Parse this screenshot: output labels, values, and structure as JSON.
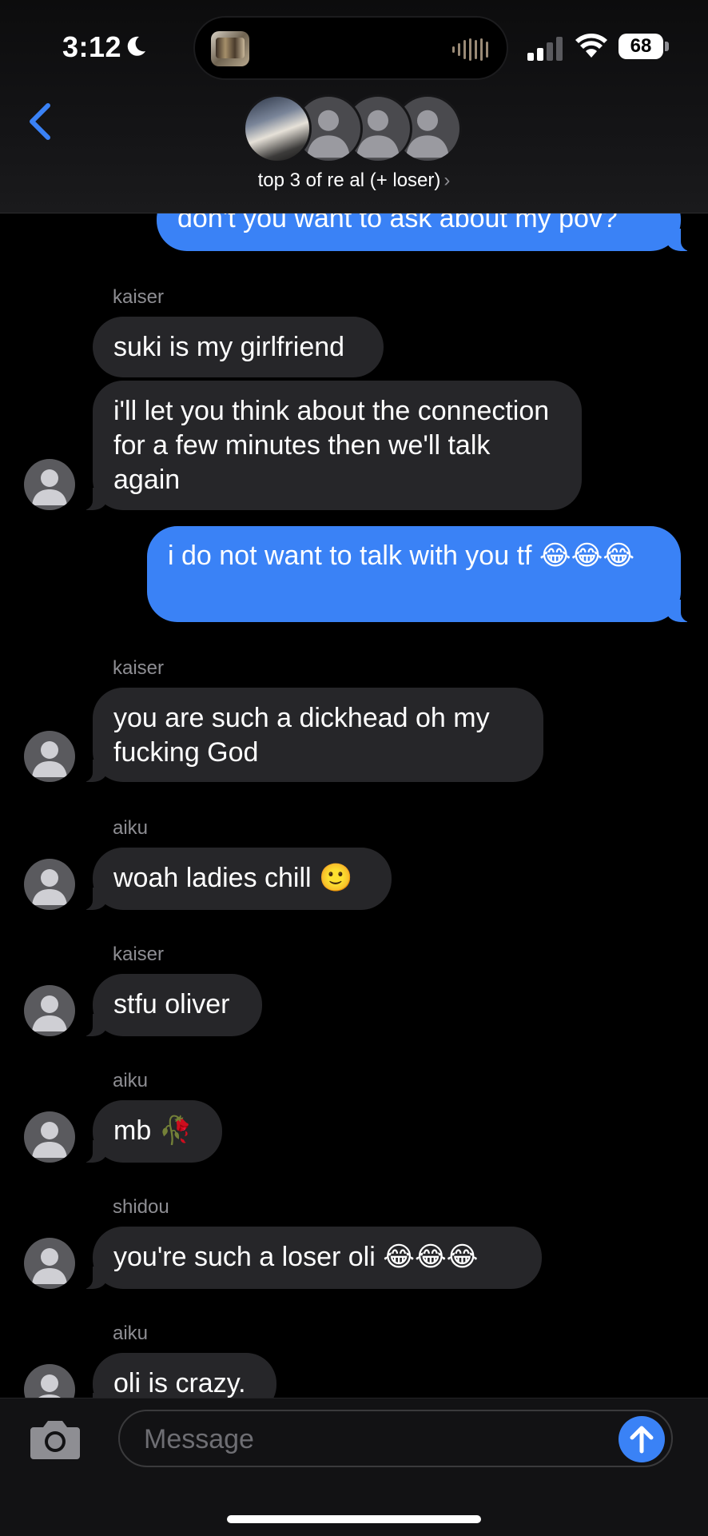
{
  "status_bar": {
    "time": "3:12",
    "battery": "68"
  },
  "header": {
    "group_name": "top 3 of re al (+ loser)",
    "chevron": "›"
  },
  "messages": [
    {
      "dir": "out",
      "text": "don't you want to ask about my pov?"
    },
    {
      "dir": "in",
      "sender": "kaiser",
      "text": "suki is my girlfriend"
    },
    {
      "dir": "in",
      "text": "i'll let you think about the connection for a few minutes then we'll talk again"
    },
    {
      "dir": "out",
      "text": "i do not want to talk with you tf 😂😂😂"
    },
    {
      "dir": "in",
      "sender": "kaiser",
      "text": "you are such a dickhead oh my fucking God"
    },
    {
      "dir": "in",
      "sender": "aiku",
      "text": "woah ladies chill 🙂"
    },
    {
      "dir": "in",
      "sender": "kaiser",
      "text": "stfu oliver"
    },
    {
      "dir": "in",
      "sender": "aiku",
      "text": "mb 🥀"
    },
    {
      "dir": "in",
      "sender": "shidou",
      "text": "you're such a loser oli 😂😂😂"
    },
    {
      "dir": "in",
      "sender": "aiku",
      "text": "oli is crazy."
    }
  ],
  "composer": {
    "placeholder": "Message"
  },
  "icons": [
    "moon-icon",
    "signal-icon",
    "wifi-icon",
    "battery-icon",
    "back-chevron-icon",
    "camera-icon",
    "send-arrow-icon",
    "person-silhouette-icon"
  ],
  "colors": {
    "accent_blue": "#3a82f6",
    "incoming_bubble": "#262629",
    "background": "#000000"
  }
}
